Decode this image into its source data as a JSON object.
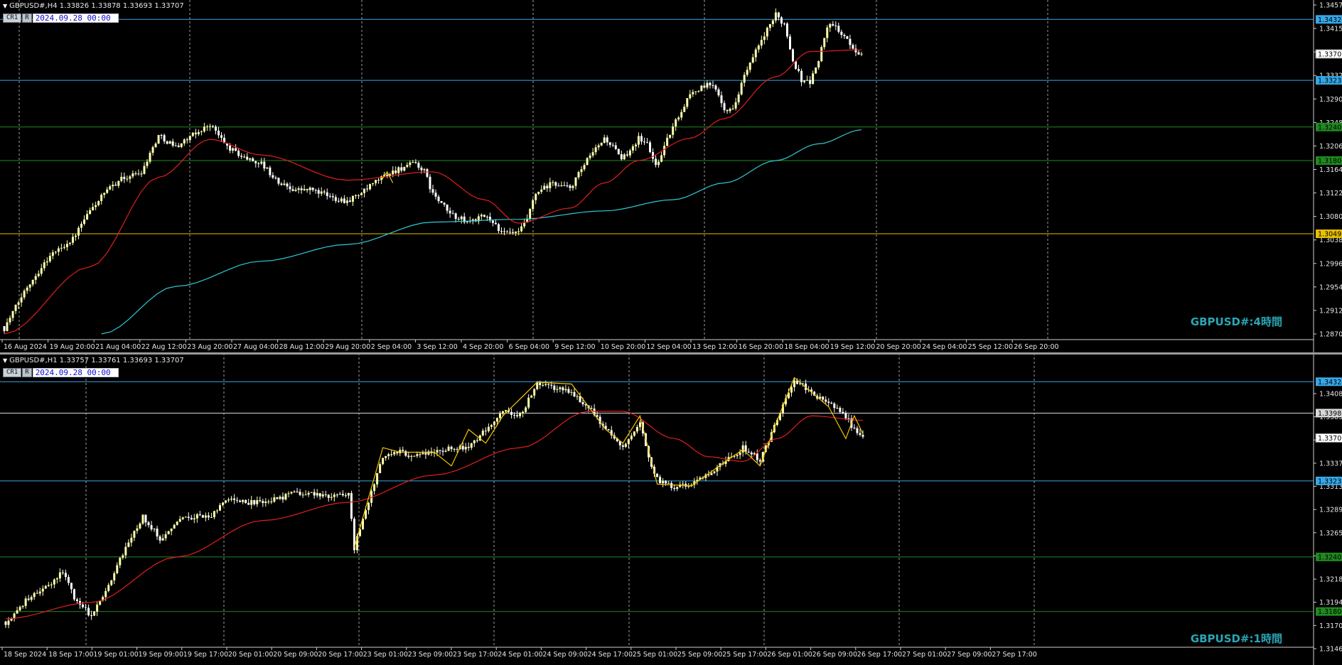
{
  "colors": {
    "background": "#000000",
    "bull_candle": "#ffffb0",
    "bear_candle": "#ffffff",
    "ma_fast": "#e01e1e",
    "ma_slow": "#2ec9d8",
    "zigzag": "#f5c400",
    "line_blue": "#35a8e8",
    "line_green": "#1f8a1f",
    "line_yellow": "#e8c000",
    "line_white": "#d8d8d8",
    "watermark": "#2aa6b5"
  },
  "chart_data": [
    {
      "type": "candlestick",
      "symbol_header": "GBPUSD#,H4  1.33826 1.33878 1.33693 1.33707",
      "panel_tags": [
        "CR1",
        "R"
      ],
      "panel_date": "2024.09.28 00:00",
      "watermark": "GBPUSD#:4時間",
      "ylim": [
        1.287,
        1.3457
      ],
      "y_ticks": [
        "1.34570",
        "1.34150",
        "1.33735",
        "1.33320",
        "1.32900",
        "1.32480",
        "1.32060",
        "1.31640",
        "1.31220",
        "1.30800",
        "1.30380",
        "1.29960",
        "1.29540",
        "1.29120",
        "1.28700"
      ],
      "x_labels": [
        "16 Aug 2024",
        "19 Aug 20:00",
        "21 Aug 04:00",
        "22 Aug 12:00",
        "23 Aug 20:00",
        "27 Aug 04:00",
        "28 Aug 12:00",
        "29 Aug 20:00",
        "2 Sep 04:00",
        "3 Sep 12:00",
        "4 Sep 20:00",
        "6 Sep 04:00",
        "9 Sep 12:00",
        "10 Sep 20:00",
        "12 Sep 04:00",
        "13 Sep 12:00",
        "16 Sep 20:00",
        "18 Sep 04:00",
        "19 Sep 12:00",
        "20 Sep 20:00",
        "24 Sep 04:00",
        "25 Sep 12:00",
        "26 Sep 20:00"
      ],
      "levels": [
        {
          "price": 1.34325,
          "label": "1.34325",
          "color": "#35a8e8"
        },
        {
          "price": 1.33235,
          "label": "1.33235",
          "color": "#35a8e8"
        },
        {
          "price": 1.324,
          "label": "1.32400",
          "color": "#1f8a1f"
        },
        {
          "price": 1.318,
          "label": "1.31800",
          "color": "#1f8a1f"
        },
        {
          "price": 1.30491,
          "label": "1.30491",
          "color": "#e8c000"
        }
      ],
      "current_price": {
        "price": 1.33707,
        "label": "1.33707"
      },
      "close_anchors": [
        [
          0,
          1.288
        ],
        [
          8,
          1.2955
        ],
        [
          16,
          1.301
        ],
        [
          24,
          1.304
        ],
        [
          30,
          1.309
        ],
        [
          34,
          1.3115
        ],
        [
          40,
          1.3145
        ],
        [
          48,
          1.316
        ],
        [
          54,
          1.3225
        ],
        [
          60,
          1.3205
        ],
        [
          66,
          1.3225
        ],
        [
          72,
          1.3245
        ],
        [
          78,
          1.3205
        ],
        [
          84,
          1.3185
        ],
        [
          90,
          1.3175
        ],
        [
          96,
          1.314
        ],
        [
          102,
          1.3128
        ],
        [
          108,
          1.3128
        ],
        [
          114,
          1.3115
        ],
        [
          120,
          1.3108
        ],
        [
          126,
          1.3125
        ],
        [
          132,
          1.315
        ],
        [
          138,
          1.3165
        ],
        [
          144,
          1.3175
        ],
        [
          147,
          1.316
        ],
        [
          150,
          1.312
        ],
        [
          156,
          1.3085
        ],
        [
          162,
          1.307
        ],
        [
          168,
          1.308
        ],
        [
          171,
          1.3072
        ],
        [
          174,
          1.305
        ],
        [
          180,
          1.305
        ],
        [
          183,
          1.3075
        ],
        [
          186,
          1.312
        ],
        [
          192,
          1.314
        ],
        [
          198,
          1.313
        ],
        [
          204,
          1.318
        ],
        [
          210,
          1.322
        ],
        [
          213,
          1.3205
        ],
        [
          216,
          1.318
        ],
        [
          222,
          1.322
        ],
        [
          225,
          1.321
        ],
        [
          228,
          1.317
        ],
        [
          234,
          1.324
        ],
        [
          240,
          1.33
        ],
        [
          246,
          1.3315
        ],
        [
          249,
          1.331
        ],
        [
          252,
          1.3275
        ],
        [
          255,
          1.327
        ],
        [
          258,
          1.332
        ],
        [
          264,
          1.3385
        ],
        [
          270,
          1.344
        ],
        [
          273,
          1.3425
        ],
        [
          276,
          1.336
        ],
        [
          279,
          1.3325
        ],
        [
          282,
          1.332
        ],
        [
          285,
          1.336
        ],
        [
          288,
          1.342
        ],
        [
          291,
          1.342
        ],
        [
          294,
          1.34
        ],
        [
          297,
          1.338
        ],
        [
          300,
          1.3371
        ]
      ],
      "ma_fast_anchors": [
        [
          0,
          1.287
        ],
        [
          30,
          1.299
        ],
        [
          54,
          1.315
        ],
        [
          72,
          1.3218
        ],
        [
          90,
          1.319
        ],
        [
          120,
          1.3145
        ],
        [
          150,
          1.316
        ],
        [
          168,
          1.311
        ],
        [
          180,
          1.3068
        ],
        [
          198,
          1.3095
        ],
        [
          210,
          1.314
        ],
        [
          222,
          1.318
        ],
        [
          240,
          1.322
        ],
        [
          252,
          1.3255
        ],
        [
          270,
          1.333
        ],
        [
          282,
          1.3375
        ],
        [
          300,
          1.3378
        ]
      ],
      "ma_slow_anchors": [
        [
          34,
          1.287
        ],
        [
          60,
          1.2955
        ],
        [
          90,
          1.3
        ],
        [
          120,
          1.303
        ],
        [
          150,
          1.307
        ],
        [
          180,
          1.3075
        ],
        [
          210,
          1.309
        ],
        [
          234,
          1.311
        ],
        [
          252,
          1.314
        ],
        [
          270,
          1.318
        ],
        [
          285,
          1.321
        ],
        [
          300,
          1.3235
        ]
      ],
      "zigzag_points": [
        [
          132,
          1.3145
        ],
        [
          134,
          1.316
        ],
        [
          136,
          1.314
        ]
      ]
    },
    {
      "type": "candlestick",
      "symbol_header": "GBPUSD#,H1  1.33757 1.33761 1.33693 1.33707",
      "panel_tags": [
        "CR1",
        "R"
      ],
      "panel_date": "2024.09.28 00:00",
      "watermark": "GBPUSD#:1時間",
      "ylim": [
        1.3147,
        1.3453
      ],
      "y_ticks": [
        "1.34085",
        "1.33850",
        "1.33610",
        "1.33375",
        "1.33135",
        "1.32895",
        "1.32655",
        "1.32420",
        "1.32180",
        "1.31940",
        "1.31700",
        "1.31465"
      ],
      "x_labels": [
        "18 Sep 2024",
        "18 Sep 17:00",
        "19 Sep 01:00",
        "19 Sep 09:00",
        "19 Sep 17:00",
        "20 Sep 01:00",
        "20 Sep 09:00",
        "20 Sep 17:00",
        "23 Sep 01:00",
        "23 Sep 09:00",
        "23 Sep 17:00",
        "24 Sep 01:00",
        "24 Sep 09:00",
        "24 Sep 17:00",
        "25 Sep 01:00",
        "25 Sep 09:00",
        "25 Sep 17:00",
        "26 Sep 01:00",
        "26 Sep 09:00",
        "26 Sep 17:00",
        "27 Sep 01:00",
        "27 Sep 09:00",
        "27 Sep 17:00"
      ],
      "levels": [
        {
          "price": 1.34325,
          "label": "1.34325",
          "color": "#35a8e8"
        },
        {
          "price": 1.3398,
          "label": "1.33980",
          "color": "#d8d8d8"
        },
        {
          "price": 1.33235,
          "label": "1.33235",
          "color": "#35a8e8"
        },
        {
          "price": 1.324,
          "label": "1.32400",
          "color": "#1f8a1f"
        },
        {
          "price": 1.318,
          "label": "1.31800",
          "color": "#1f8a1f"
        }
      ],
      "current_price": {
        "price": 1.33707,
        "label": "1.33707"
      },
      "close_anchors": [
        [
          0,
          1.3165
        ],
        [
          8,
          1.3195
        ],
        [
          16,
          1.321
        ],
        [
          20,
          1.3225
        ],
        [
          24,
          1.3195
        ],
        [
          30,
          1.3175
        ],
        [
          36,
          1.321
        ],
        [
          42,
          1.325
        ],
        [
          48,
          1.3285
        ],
        [
          54,
          1.326
        ],
        [
          60,
          1.328
        ],
        [
          66,
          1.3285
        ],
        [
          72,
          1.3285
        ],
        [
          78,
          1.3305
        ],
        [
          84,
          1.33
        ],
        [
          90,
          1.33
        ],
        [
          96,
          1.3305
        ],
        [
          102,
          1.331
        ],
        [
          108,
          1.331
        ],
        [
          114,
          1.3305
        ],
        [
          120,
          1.331
        ],
        [
          122,
          1.325
        ],
        [
          126,
          1.329
        ],
        [
          132,
          1.335
        ],
        [
          138,
          1.3355
        ],
        [
          144,
          1.335
        ],
        [
          150,
          1.3355
        ],
        [
          156,
          1.336
        ],
        [
          162,
          1.336
        ],
        [
          168,
          1.338
        ],
        [
          174,
          1.34
        ],
        [
          180,
          1.3395
        ],
        [
          186,
          1.343
        ],
        [
          192,
          1.3425
        ],
        [
          198,
          1.342
        ],
        [
          204,
          1.3405
        ],
        [
          210,
          1.338
        ],
        [
          213,
          1.337
        ],
        [
          216,
          1.336
        ],
        [
          222,
          1.3385
        ],
        [
          225,
          1.335
        ],
        [
          228,
          1.3325
        ],
        [
          234,
          1.3315
        ],
        [
          240,
          1.332
        ],
        [
          246,
          1.333
        ],
        [
          252,
          1.3345
        ],
        [
          258,
          1.336
        ],
        [
          261,
          1.3355
        ],
        [
          264,
          1.3345
        ],
        [
          270,
          1.339
        ],
        [
          276,
          1.3435
        ],
        [
          282,
          1.342
        ],
        [
          288,
          1.341
        ],
        [
          294,
          1.3395
        ],
        [
          297,
          1.338
        ],
        [
          300,
          1.337
        ]
      ],
      "ma_fast_anchors": [
        [
          0,
          1.3172
        ],
        [
          30,
          1.319
        ],
        [
          60,
          1.324
        ],
        [
          90,
          1.328
        ],
        [
          120,
          1.33
        ],
        [
          150,
          1.333
        ],
        [
          180,
          1.336
        ],
        [
          204,
          1.34
        ],
        [
          216,
          1.34
        ],
        [
          234,
          1.337
        ],
        [
          246,
          1.335
        ],
        [
          258,
          1.3345
        ],
        [
          270,
          1.337
        ],
        [
          282,
          1.3395
        ],
        [
          300,
          1.339
        ]
      ],
      "ma_slow_anchors": [],
      "zigzag_points": [
        [
          122,
          1.325
        ],
        [
          132,
          1.336
        ],
        [
          138,
          1.3355
        ],
        [
          150,
          1.3355
        ],
        [
          156,
          1.334
        ],
        [
          162,
          1.338
        ],
        [
          168,
          1.3365
        ],
        [
          174,
          1.3395
        ],
        [
          186,
          1.3432
        ],
        [
          198,
          1.343
        ],
        [
          210,
          1.338
        ],
        [
          216,
          1.3365
        ],
        [
          222,
          1.3395
        ],
        [
          228,
          1.332
        ],
        [
          240,
          1.3318
        ],
        [
          252,
          1.3345
        ],
        [
          258,
          1.3358
        ],
        [
          264,
          1.334
        ],
        [
          270,
          1.339
        ],
        [
          276,
          1.3437
        ],
        [
          288,
          1.3405
        ],
        [
          294,
          1.337
        ],
        [
          297,
          1.3395
        ],
        [
          300,
          1.3375
        ]
      ]
    }
  ]
}
